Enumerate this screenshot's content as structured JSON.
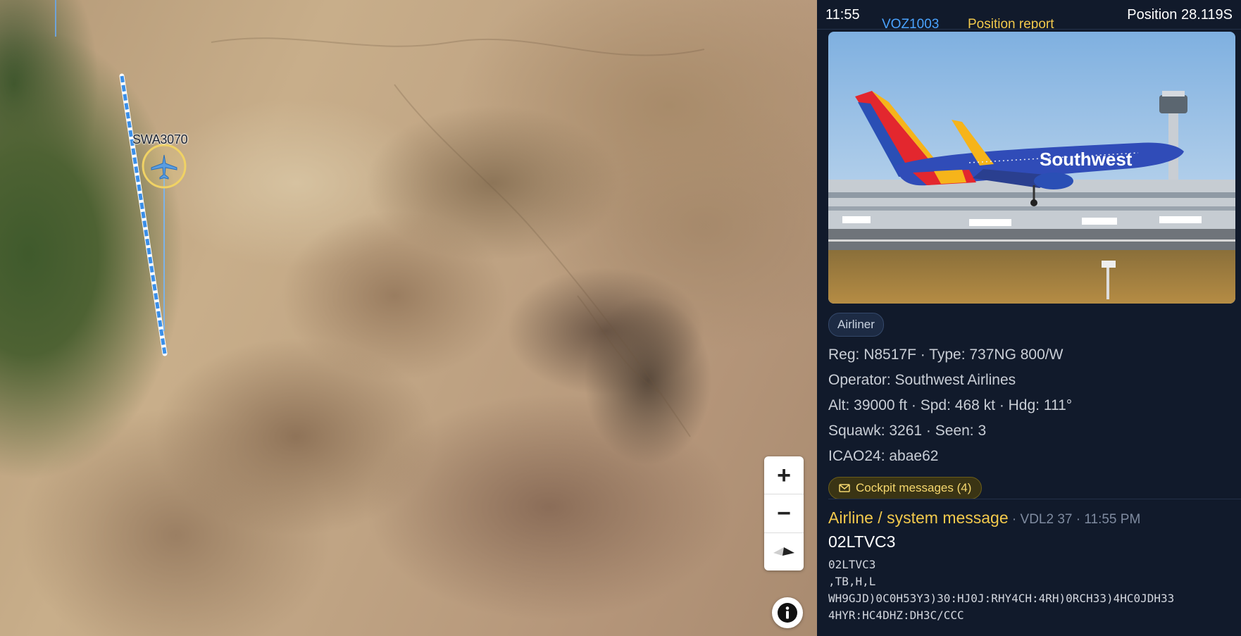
{
  "header": {
    "time": "11:55",
    "flight_id": "VOZ1003",
    "message_type": "Position report",
    "position": "Position 28.119S"
  },
  "map": {
    "flight_label": "SWA3070",
    "zoom_in_label": "+",
    "zoom_out_label": "−",
    "icons": [
      "airplane-icon",
      "zoom-in-icon",
      "zoom-out-icon",
      "compass-icon",
      "info-icon"
    ]
  },
  "aircraft": {
    "category": "Airliner",
    "reg_type": "Reg: N8517F · Type: 737NG 800/W",
    "operator": "Operator: Southwest Airlines",
    "alt_speed_heading": "Alt: 39000 ft · Spd: 468 kt · Hdg: 111°",
    "squawk_seen": "Squawk: 3261 · Seen: 3",
    "icao": "ICAO24: abae62",
    "photo_livery_text": "Southwest"
  },
  "cockpit": {
    "label": "Cockpit messages (4)"
  },
  "message": {
    "title": "Airline / system message",
    "meta": " · VDL2 37 · 11:55 PM",
    "label": "02LTVC3",
    "body": "02LTVC3\n,TB,H,L\nWH9GJD)0C0H53Y3)30:HJ0J:RHY4CH:4RH)0RCH33)4HC0JDH33\n4HYR:HC4DHZ:DH3C/CCC"
  },
  "colors": {
    "accent_blue": "#4aa3ff",
    "accent_yellow": "#f2c94c",
    "panel_bg": "#111a2b"
  }
}
